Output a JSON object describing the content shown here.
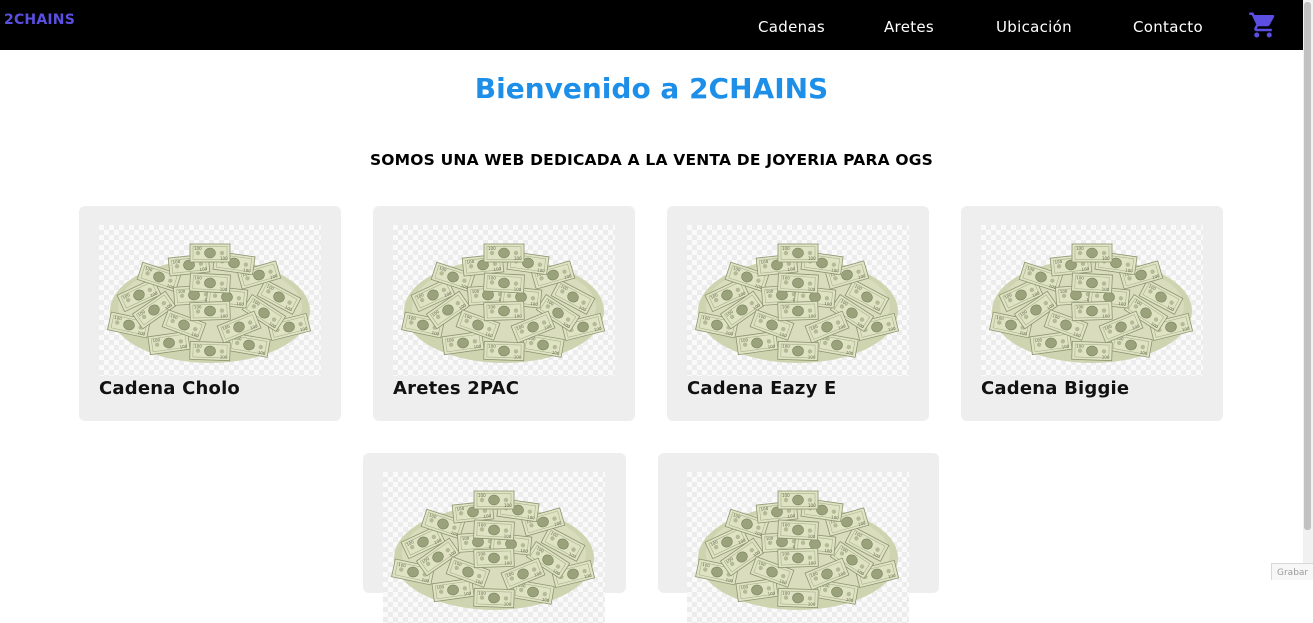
{
  "header": {
    "brand": "2CHAINS",
    "nav": [
      {
        "label": "Cadenas"
      },
      {
        "label": "Aretes"
      },
      {
        "label": "Ubicación"
      },
      {
        "label": "Contacto"
      }
    ],
    "cart_icon": "shopping-cart-icon"
  },
  "main": {
    "title": "Bienvenido a 2CHAINS",
    "subtitle": "SOMOS UNA WEB DEDICADA A LA VENTA DE JOYERIA PARA OGS",
    "products": [
      {
        "name": "Cadena Cholo",
        "image": "money-pile"
      },
      {
        "name": "Aretes 2PAC",
        "image": "money-pile"
      },
      {
        "name": "Cadena Eazy E",
        "image": "money-pile"
      },
      {
        "name": "Cadena Biggie",
        "image": "money-pile"
      },
      {
        "name": "",
        "image": "money-pile"
      },
      {
        "name": "",
        "image": "money-pile"
      }
    ]
  },
  "overlay": {
    "corner_text": "Grabar"
  },
  "colors": {
    "navbar": "#000000",
    "brand": "#5b4fe3",
    "title": "#1e8fe8",
    "cart": "#5b4fe3",
    "card": "#eeeeee"
  }
}
